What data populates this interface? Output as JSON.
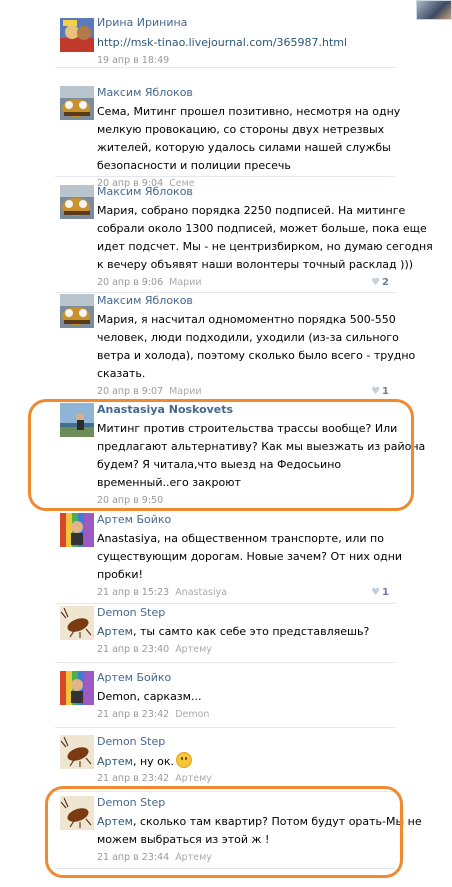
{
  "comments": [
    {
      "author": "Ирина Иринина",
      "lines": [
        {
          "link": "http://msk-tinao.livejournal.com/365987.html"
        }
      ],
      "date": "19 апр в 18:49",
      "reply_to": "",
      "likes": ""
    },
    {
      "author": "Максим Яблоков",
      "lines": [
        {
          "text": "Сема, Митинг прошел позитивно, несмотря на одну"
        },
        {
          "text": "мелкую провокацию, со стороны двух нетрезвых"
        },
        {
          "text": "жителей, которую удалось силами нашей службы"
        },
        {
          "text": "безопасности и полиции пресечь"
        }
      ],
      "date": "20 апр в 9:04",
      "reply_to": "Семе",
      "likes": ""
    },
    {
      "author": "Максим Яблоков",
      "lines": [
        {
          "text": "Мария, собрано порядка 2250 подписей. На митинге"
        },
        {
          "text": "собрали около 1300 подписей, может больше, пока еще"
        },
        {
          "text": "идет подсчет. Мы - не центризбирком, но думаю сегодня"
        },
        {
          "text": "к вечеру объявят наши волонтеры точный расклад )))"
        }
      ],
      "date": "20 апр в 9:06",
      "reply_to": "Марии",
      "likes": "2"
    },
    {
      "author": "Максим Яблоков",
      "lines": [
        {
          "text": "Мария, я насчитал одномоментно порядка 500-550"
        },
        {
          "text": "человек, люди подходили, уходили (из-за сильного"
        },
        {
          "text": "ветра и холода), поэтому сколько было всего - трудно"
        },
        {
          "text": "сказать."
        }
      ],
      "date": "20 апр в 9:07",
      "reply_to": "Марии",
      "likes": "1"
    },
    {
      "author": "Anastasiya Noskovets",
      "lines": [
        {
          "text": "Митинг против строительства трассы вообще? Или"
        },
        {
          "text": "предлагают альтернативу? Как мы выезжать из района"
        },
        {
          "text": "будем? Я читала,что выезд на Федосьино"
        },
        {
          "text": "временный..его закроют"
        }
      ],
      "date": "20 апр в 9:50",
      "reply_to": "",
      "likes": ""
    },
    {
      "author": "Артем Бойко",
      "lines": [
        {
          "text": "Anastasiya, на общественном транспорте, или по"
        },
        {
          "text": "существующим дорогам. Новые зачем? От них одни"
        },
        {
          "text": "пробки!"
        }
      ],
      "date": "21 апр в 15:23",
      "reply_to": "Anastasiya",
      "likes": "1"
    },
    {
      "author": "Demon Step",
      "lines": [
        {
          "addr": "Артем",
          "text": ", ты самто как себе это представляешь?"
        }
      ],
      "date": "21 апр в 23:40",
      "reply_to": "Артему",
      "likes": ""
    },
    {
      "author": "Артем Бойко",
      "lines": [
        {
          "text": "Demon, сарказм..."
        }
      ],
      "date": "21 апр в 23:42",
      "reply_to": "Demon",
      "likes": ""
    },
    {
      "author": "Demon Step",
      "lines": [
        {
          "addr": "Артем",
          "text": ", ну ок."
        }
      ],
      "date": "21 апр в 23:42",
      "reply_to": "Артему",
      "likes": ""
    },
    {
      "author": "Demon Step",
      "lines": [
        {
          "addr": "Артем",
          "text": ", сколько там квартир? Потом будут орать-Мы не"
        },
        {
          "text": "можем выбраться из этой ж     !"
        }
      ],
      "date": "21 апр в 23:44",
      "reply_to": "Артему",
      "likes": ""
    }
  ],
  "icons": {
    "like": "heart-icon",
    "emoji": "smiley-icon"
  },
  "colors": {
    "author": "#45688e",
    "highlight": "#f08a30",
    "meta": "#999999"
  }
}
